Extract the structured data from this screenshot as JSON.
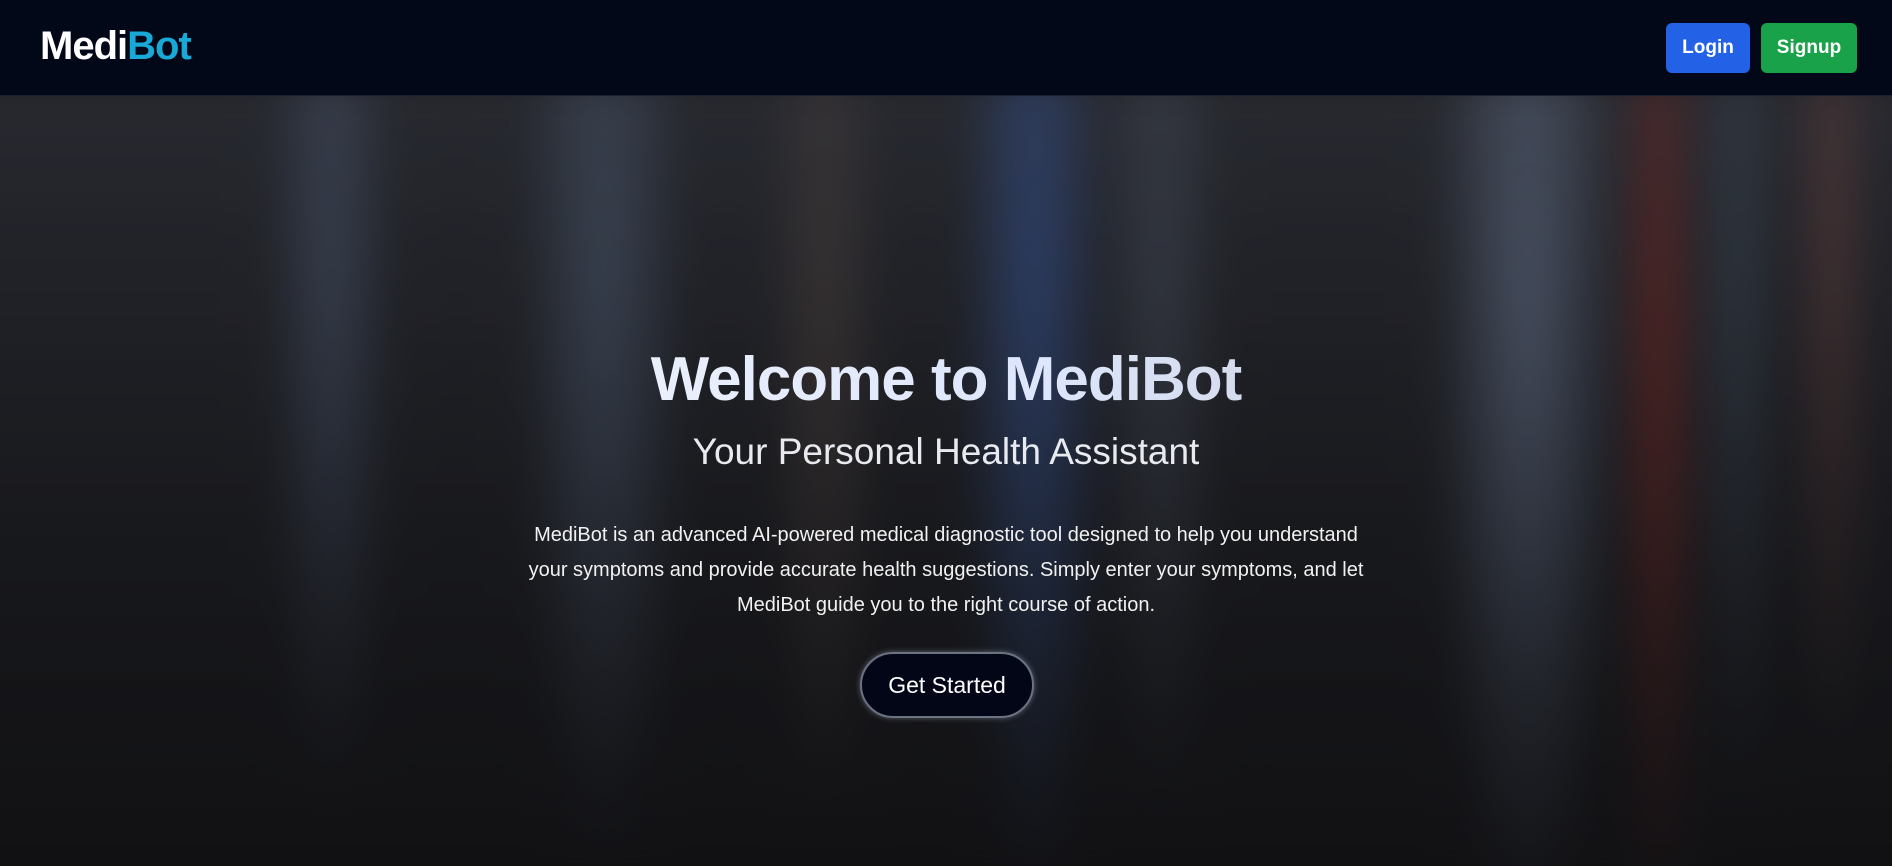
{
  "navbar": {
    "logo_part1": "Medi",
    "logo_part2": "Bot",
    "login_label": "Login",
    "signup_label": "Signup"
  },
  "hero": {
    "title": "Welcome to MediBot",
    "subtitle": "Your Personal Health Assistant",
    "description": "MediBot is an advanced AI-powered medical diagnostic tool designed to help you understand your symptoms and provide accurate health suggestions. Simply enter your symptoms, and let MediBot guide you to the right course of action.",
    "cta_label": "Get Started"
  },
  "colors": {
    "navbar_bg": "#030818",
    "logo_accent": "#19a9d6",
    "login_button": "#2361e6",
    "signup_button": "#19a249",
    "cta_bg": "#020617"
  }
}
